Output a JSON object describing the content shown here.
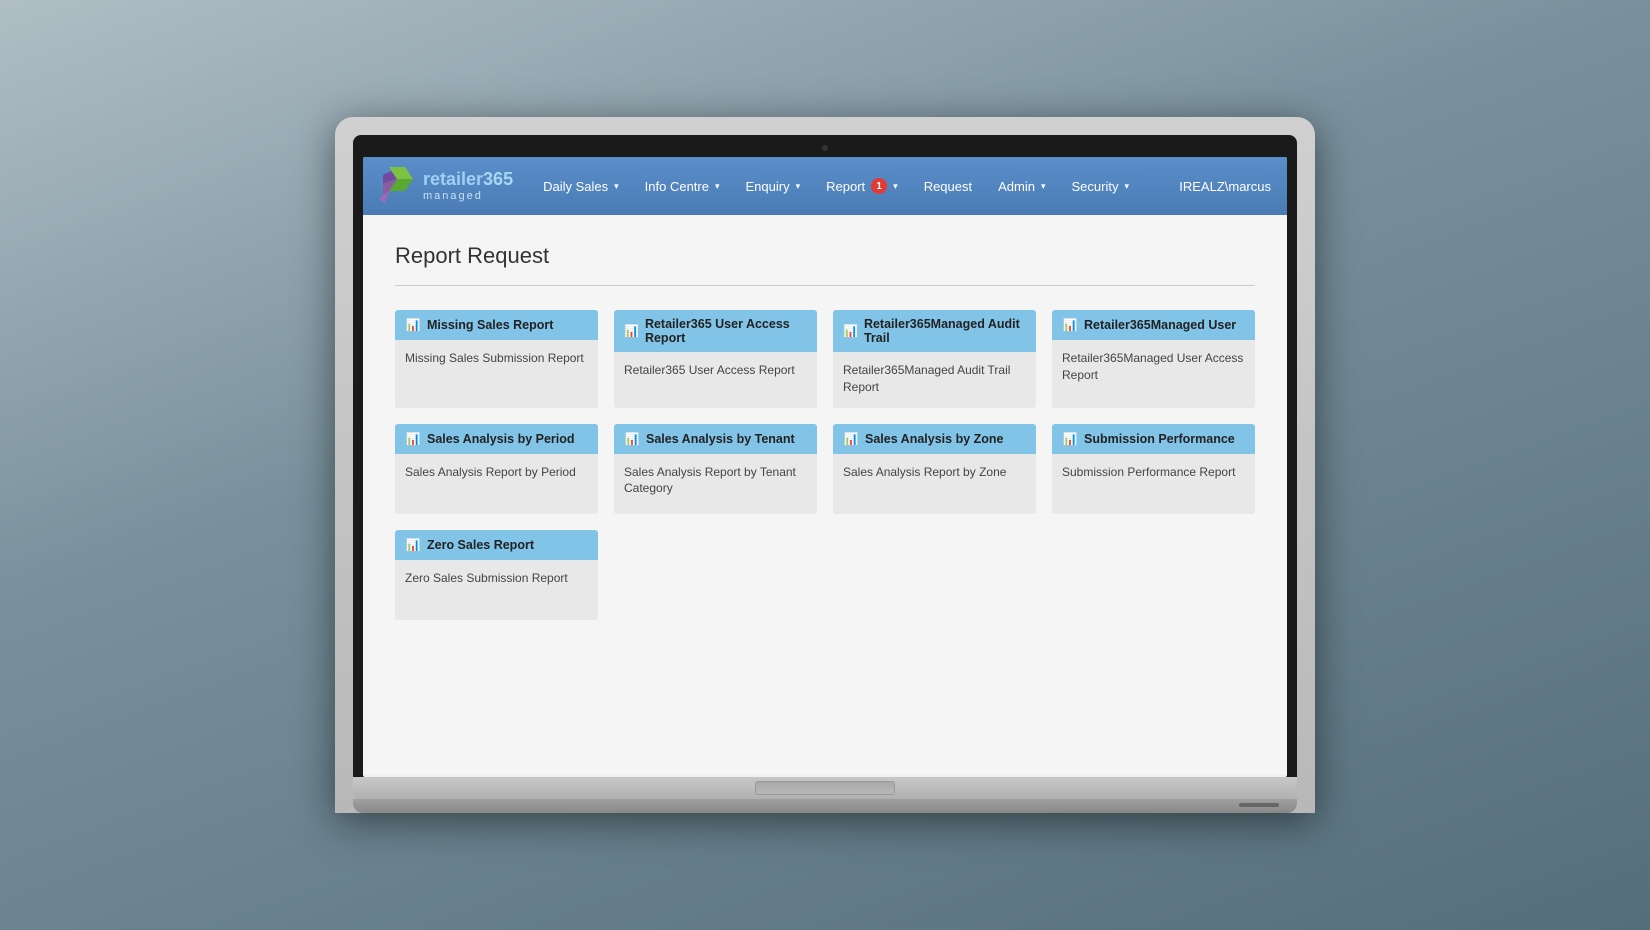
{
  "app": {
    "brand": "retailer",
    "brand_number": "365",
    "brand_sub": "managed",
    "user": "IREALZ\\marcus"
  },
  "nav": {
    "items": [
      {
        "label": "Daily Sales",
        "has_dropdown": true,
        "badge": null
      },
      {
        "label": "Info Centre",
        "has_dropdown": true,
        "badge": null
      },
      {
        "label": "Enquiry",
        "has_dropdown": true,
        "badge": null
      },
      {
        "label": "Report",
        "has_dropdown": true,
        "badge": "1"
      },
      {
        "label": "Request",
        "has_dropdown": false,
        "badge": null
      },
      {
        "label": "Admin",
        "has_dropdown": true,
        "badge": null
      },
      {
        "label": "Security",
        "has_dropdown": true,
        "badge": null
      }
    ]
  },
  "page": {
    "title": "Report Request"
  },
  "reports": [
    {
      "title": "Missing Sales Report",
      "description": "Missing Sales Submission Report"
    },
    {
      "title": "Retailer365 User Access Report",
      "description": "Retailer365 User Access Report"
    },
    {
      "title": "Retailer365Managed Audit Trail",
      "description": "Retailer365Managed Audit Trail Report"
    },
    {
      "title": "Retailer365Managed User",
      "description": "Retailer365Managed User Access Report"
    },
    {
      "title": "Sales Analysis by Period",
      "description": "Sales Analysis Report by Period"
    },
    {
      "title": "Sales Analysis by Tenant",
      "description": "Sales Analysis Report by Tenant Category"
    },
    {
      "title": "Sales Analysis by Zone",
      "description": "Sales Analysis Report by Zone"
    },
    {
      "title": "Submission Performance",
      "description": "Submission Performance Report"
    },
    {
      "title": "Zero Sales Report",
      "description": "Zero Sales Submission Report"
    }
  ]
}
